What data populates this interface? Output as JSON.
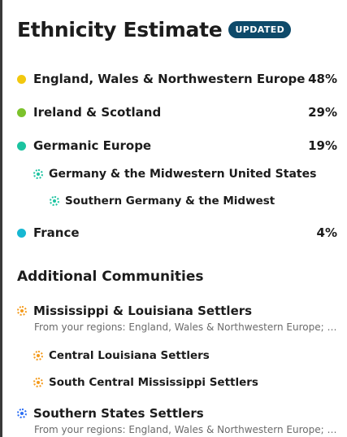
{
  "header": {
    "title": "Ethnicity Estimate",
    "badge": "UPDATED"
  },
  "regions": [
    {
      "label": "England, Wales & Northwestern Europe",
      "percent": "48%",
      "color": "#f2c80f"
    },
    {
      "label": "Ireland & Scotland",
      "percent": "29%",
      "color": "#7cc22c"
    },
    {
      "label": "Germanic Europe",
      "percent": "19%",
      "color": "#1bc3a0"
    },
    {
      "label": "France",
      "percent": "4%",
      "color": "#17b7d2"
    }
  ],
  "subregions": [
    {
      "label": "Germany & the Midwestern United States",
      "color": "#1bc3a0"
    },
    {
      "label": "Southern Germany & the Midwest",
      "color": "#1bc3a0"
    }
  ],
  "communities_section": {
    "title": "Additional Communities",
    "items": [
      {
        "label": "Mississippi & Louisiana Settlers",
        "desc": "From your regions: England, Wales & Northwestern Europe; Ireland & Scotland",
        "color": "#f49a1b",
        "children": [
          {
            "label": "Central Louisiana Settlers",
            "color": "#f49a1b"
          },
          {
            "label": "South Central Mississippi Settlers",
            "color": "#f49a1b"
          }
        ]
      },
      {
        "label": "Southern States Settlers",
        "desc": "From your regions: England, Wales & Northwestern Europe; Ireland & Scotland",
        "color": "#2a6df4"
      }
    ]
  }
}
